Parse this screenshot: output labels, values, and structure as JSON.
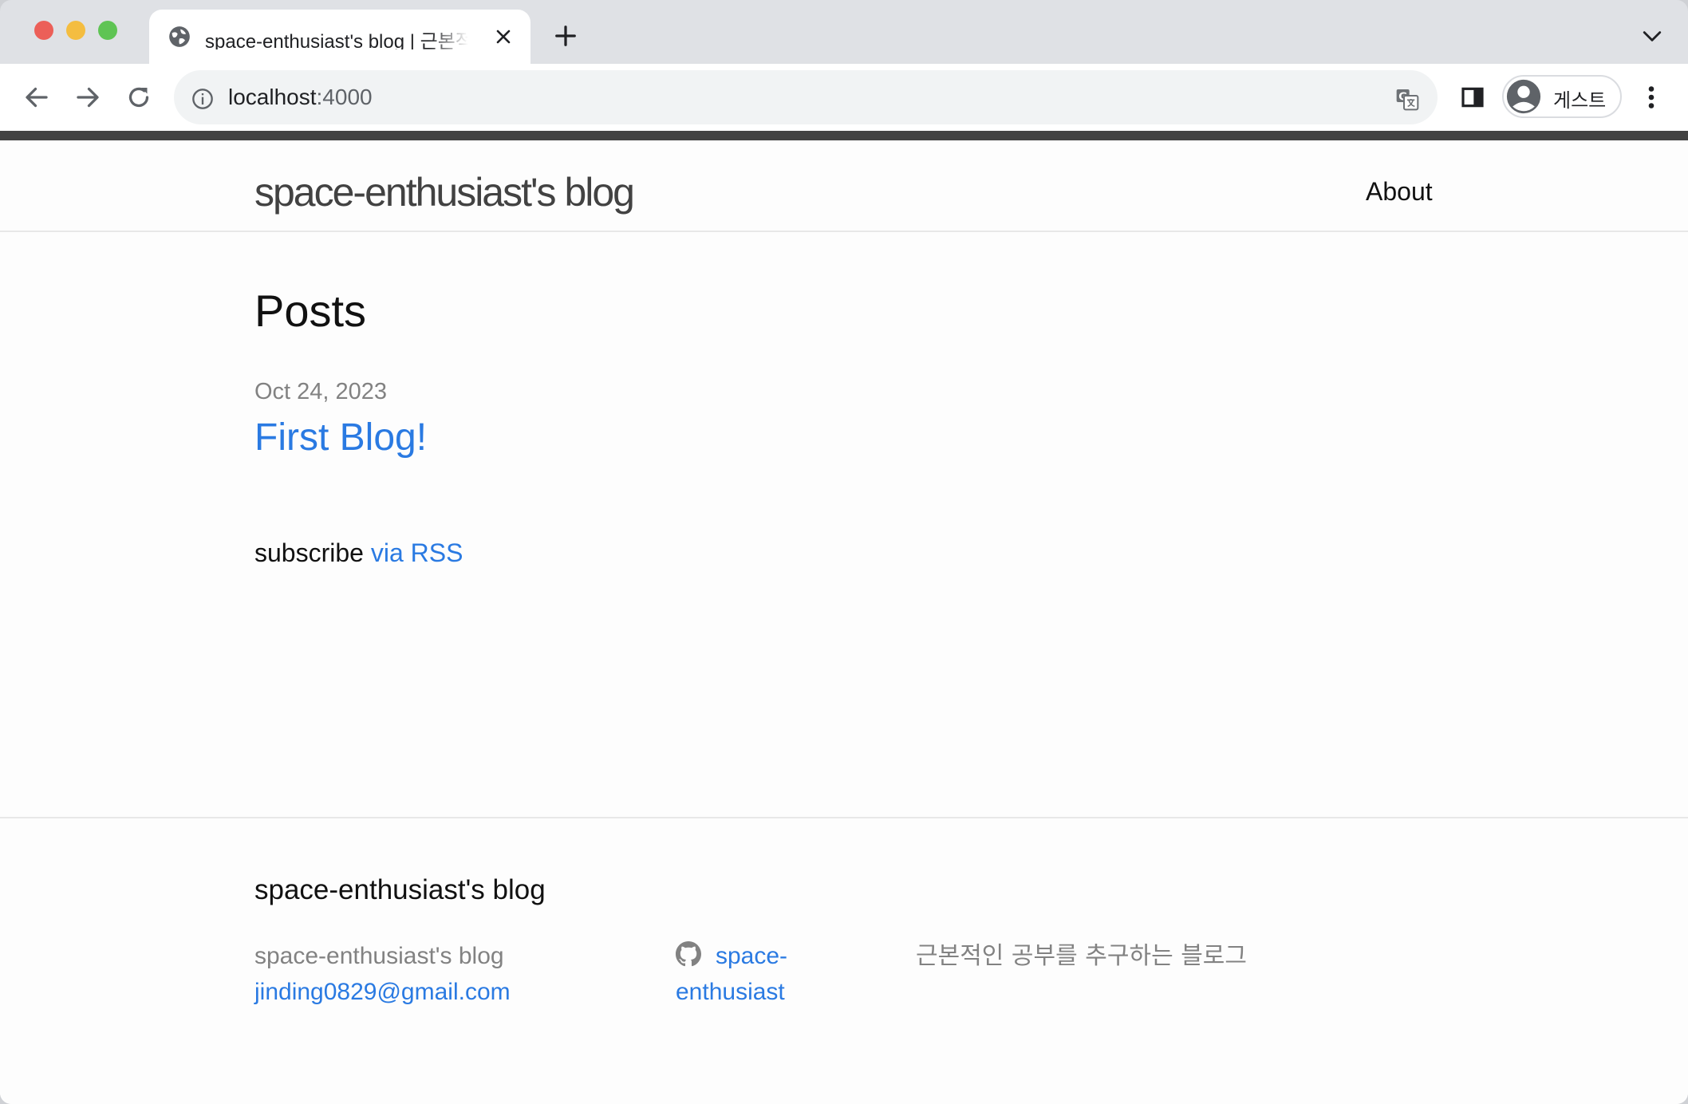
{
  "browser": {
    "tab": {
      "title": "space-enthusiast's blog | 근본적",
      "icon": "globe-icon"
    },
    "url": {
      "host": "localhost",
      "port": ":4000"
    },
    "profile_label": "게스트"
  },
  "site": {
    "title": "space-enthusiast's blog",
    "nav": {
      "about": "About"
    }
  },
  "main": {
    "heading": "Posts",
    "posts": [
      {
        "date": "Oct 24, 2023",
        "title": "First Blog!"
      }
    ],
    "subscribe_prefix": "subscribe",
    "subscribe_link": "via RSS"
  },
  "footer": {
    "heading": "space-enthusiast's blog",
    "author_name": "space-enthusiast's blog",
    "email": "jinding0829@gmail.com",
    "github_line1": "space-",
    "github_line2": "enthusiast",
    "description": "근본적인 공부를 추구하는 블로그"
  },
  "colors": {
    "link": "#2a7ae2",
    "text": "#111111",
    "muted": "#828282",
    "topbar": "#424242"
  }
}
